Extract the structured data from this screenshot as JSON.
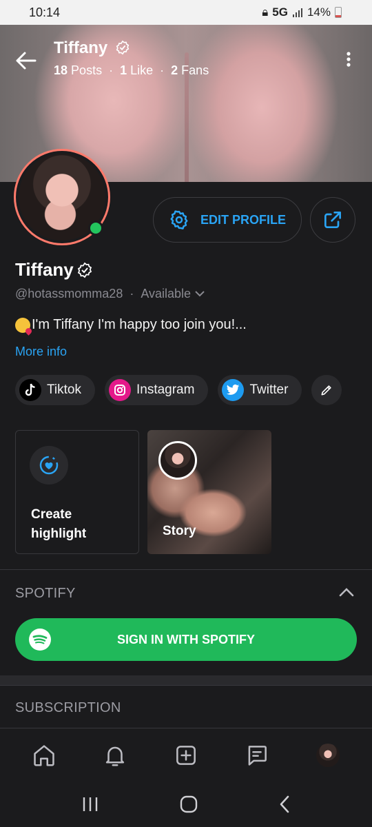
{
  "status_bar": {
    "time": "10:14",
    "network": "5G",
    "battery": "14%"
  },
  "header": {
    "name": "Tiffany",
    "stats": [
      {
        "count": "18",
        "label": "Posts"
      },
      {
        "count": "1",
        "label": "Like"
      },
      {
        "count": "2",
        "label": "Fans"
      }
    ]
  },
  "profile": {
    "edit_label": "EDIT PROFILE",
    "name": "Tiffany",
    "handle": "@hotassmomma28",
    "availability": "Available",
    "bio": "I'm Tiffany I'm happy too join you!...",
    "more_info": "More info"
  },
  "socials": [
    {
      "label": "Tiktok",
      "color": "#000000"
    },
    {
      "label": "Instagram",
      "color": "#e4198a"
    },
    {
      "label": "Twitter",
      "color": "#1d9bf0"
    }
  ],
  "highlights": {
    "create_label": "Create highlight",
    "story_label": "Story"
  },
  "spotify": {
    "section_title": "SPOTIFY",
    "button_label": "SIGN IN WITH SPOTIFY",
    "color": "#20b95a"
  },
  "subscription": {
    "section_title": "SUBSCRIPTION"
  },
  "colors": {
    "accent": "#2aa4f4",
    "online": "#23c55e",
    "avatar_ring": "#ff7a6b"
  }
}
